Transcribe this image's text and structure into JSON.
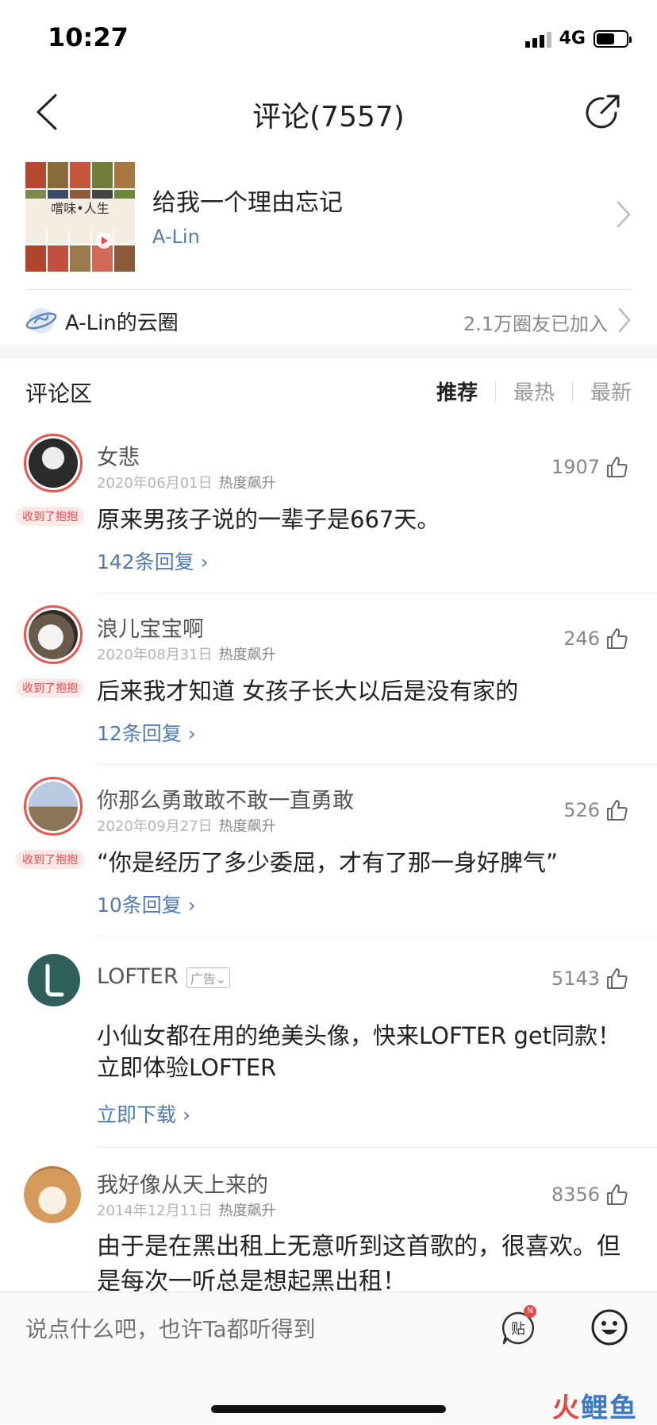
{
  "status_bar": {
    "time": "10:27",
    "network": "4G"
  },
  "nav": {
    "title": "评论(7557)"
  },
  "song": {
    "title": "给我一个理由忘记",
    "artist": "A-Lin",
    "cover_title": "嚐味•人生",
    "cover_icon": "play-icon"
  },
  "circle": {
    "label": "A-Lin的云圈",
    "joined": "2.1万圈友已加入"
  },
  "comments_header": {
    "title": "评论区",
    "sort_tabs": [
      "推荐",
      "最热",
      "最新"
    ],
    "active_sort": "推荐"
  },
  "comments": [
    {
      "user": "女悲",
      "date": "2020年06月01日",
      "tag": "热度飙升",
      "likes": "1907",
      "badge": "收到了抱抱",
      "text": "原来男孩子说的一辈子是667天。",
      "replies": "142条回复 ›"
    },
    {
      "user": "浪儿宝宝啊",
      "date": "2020年08月31日",
      "tag": "热度飙升",
      "likes": "246",
      "badge": "收到了抱抱",
      "text": "后来我才知道 女孩子长大以后是没有家的",
      "replies": "12条回复 ›"
    },
    {
      "user": "你那么勇敢敢不敢一直勇敢",
      "date": "2020年09月27日",
      "tag": "热度飙升",
      "likes": "526",
      "badge": "收到了抱抱",
      "text": "“你是经历了多少委屈，才有了那一身好脾气”",
      "replies": "10条回复 ›"
    }
  ],
  "ad": {
    "user": "LOFTER",
    "ad_label": "广告⌄",
    "likes": "5143",
    "text_line1": "小仙女都在用的绝美头像，快来LOFTER get同款！",
    "text_line2": "立即体验LOFTER",
    "cta": "立即下载 ›",
    "brand_color": "#2f5f5a"
  },
  "last_comment": {
    "user": "我好像从天上来的",
    "date": "2014年12月11日",
    "tag": "热度飙升",
    "likes": "8356",
    "text": "由于是在黑出租上无意听到这首歌的，很喜欢。但是每次一听总是想起黑出租！"
  },
  "input_bar": {
    "placeholder": "说点什么吧，也许Ta都听得到",
    "sticker_label": "贴",
    "sticker_badge": "N"
  },
  "watermark": {
    "part1": "火",
    "part2": "鲤鱼"
  },
  "colors": {
    "link": "#4f7cb7",
    "accent_red": "#e34b4b"
  }
}
